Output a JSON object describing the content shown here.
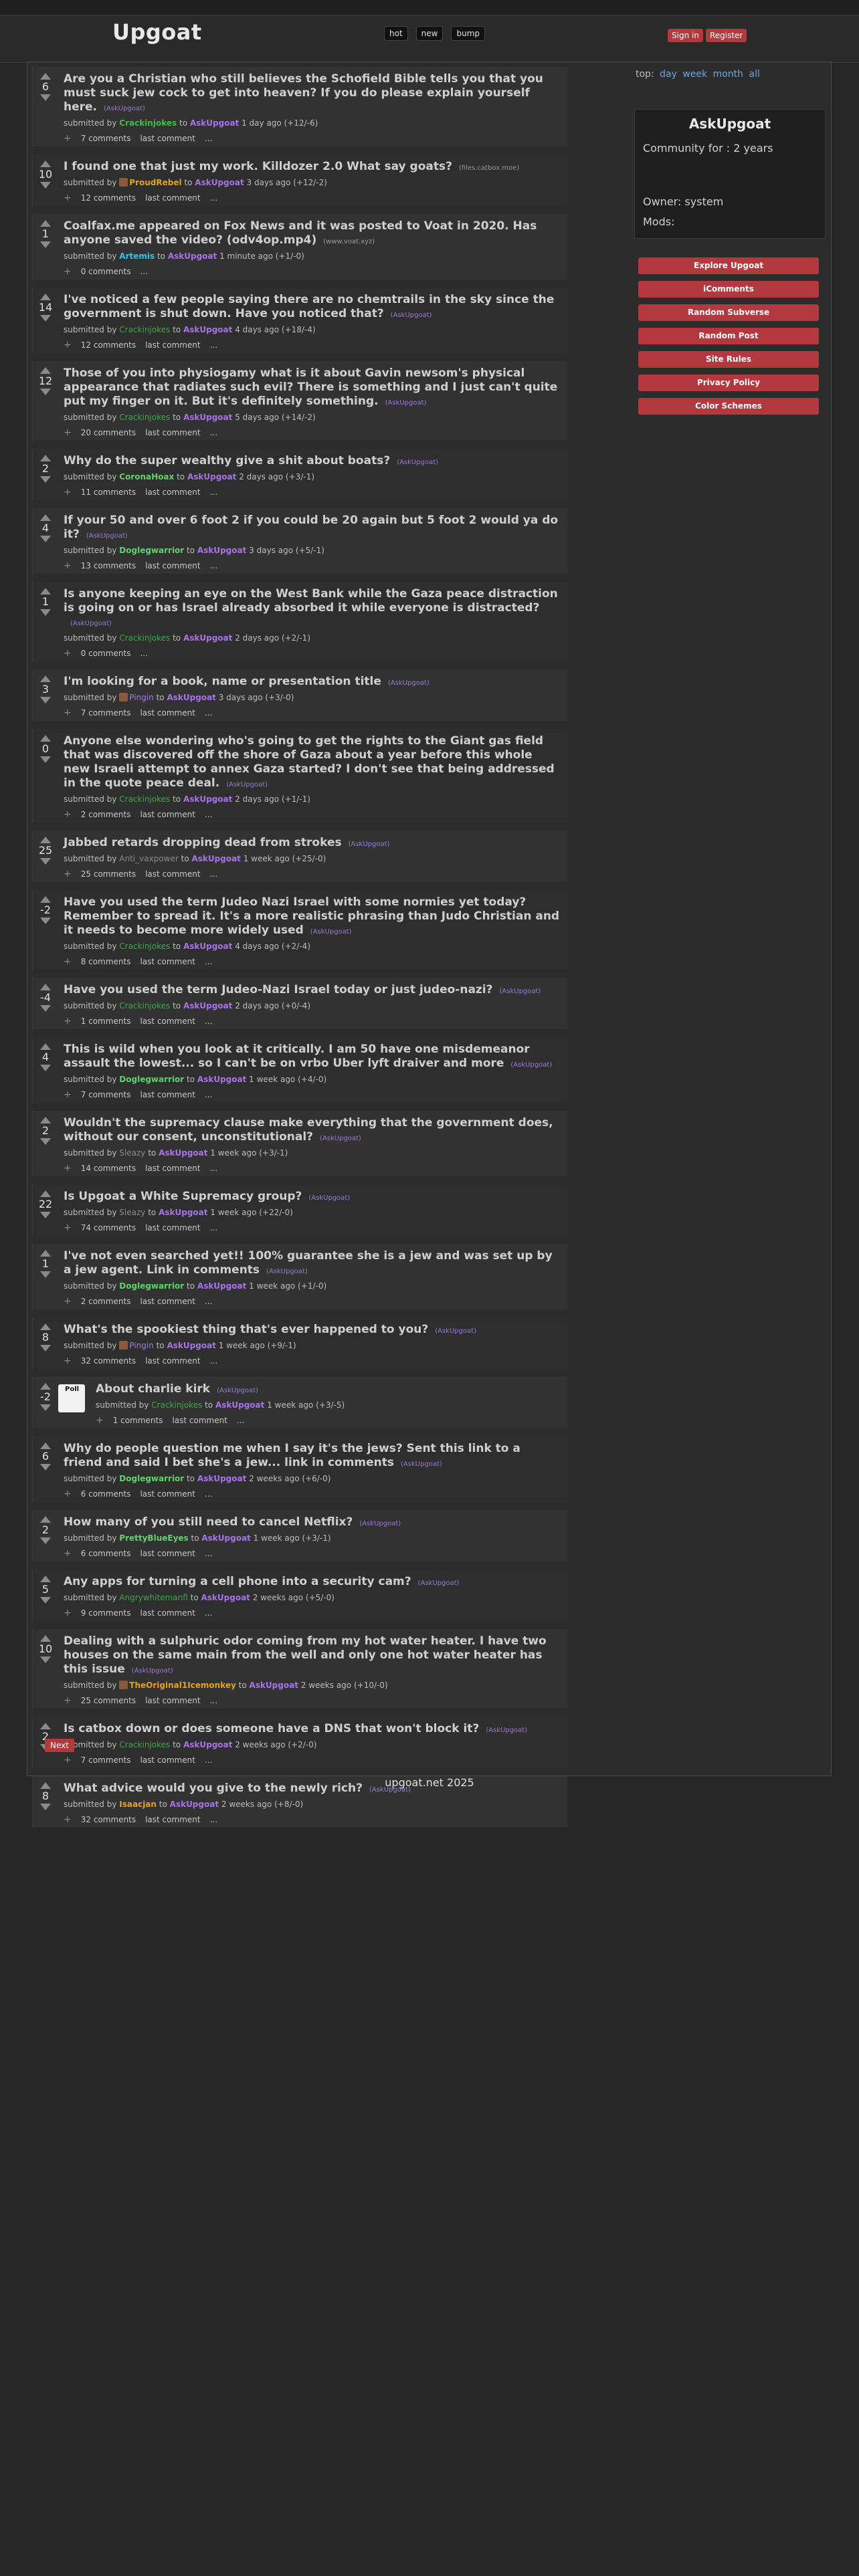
{
  "header": {
    "logo": "Upgoat",
    "sort": [
      "hot",
      "new",
      "bump"
    ],
    "sign_in": "Sign in",
    "register": "Register"
  },
  "sidebar": {
    "top_label": "top:",
    "top_links": [
      "day",
      "week",
      "month",
      "all"
    ],
    "title": "AskUpgoat",
    "community_for": "Community for : 2 years",
    "owner": "Owner: system",
    "mods": "Mods:",
    "buttons": [
      "Explore Upgoat",
      "iComments",
      "Random Subverse",
      "Random Post",
      "Site Rules",
      "Privacy Policy",
      "Color Schemes"
    ]
  },
  "posts": [
    {
      "score": "6",
      "title": "Are you a Christian who still believes the Schofield Bible tells you that you must suck jew cock to get into heaven? If you do please explain yourself here.",
      "tag": "(AskUpgoat)",
      "domain": "",
      "user": "Crackinjokes",
      "ucls": "",
      "sub": "AskUpgoat",
      "time": "1 day ago (+12/-6)",
      "comments": "7 comments",
      "last": "last comment",
      "more": "...",
      "avatar": false
    },
    {
      "score": "10",
      "title": "I found one that just my work. Killdozer 2.0 What say goats?",
      "tag": "",
      "domain": "(files.catbox.moe)",
      "user": "ProudRebel",
      "ucls": "yellow",
      "sub": "AskUpgoat",
      "time": "3 days ago (+12/-2)",
      "comments": "12 comments",
      "last": "last comment",
      "more": "...",
      "avatar": true
    },
    {
      "score": "1",
      "title": "Coalfax.me appeared on Fox News and it was posted to Voat in 2020. Has anyone saved the video? (odv4op.mp4)",
      "tag": "",
      "domain": "(www.voat.xyz)",
      "user": "Artemis",
      "ucls": "blue",
      "sub": "AskUpgoat",
      "time": "1 minute ago (+1/-0)",
      "comments": "0 comments",
      "last": "",
      "more": "...",
      "avatar": false
    },
    {
      "score": "14",
      "title": "I've noticed a few people saying there are no chemtrails in the sky since the government is shut down. Have you noticed that?",
      "tag": "(AskUpgoat)",
      "domain": "",
      "user": "Crackinjokes",
      "ucls": "dimgreen",
      "sub": "AskUpgoat",
      "time": "4 days ago (+18/-4)",
      "comments": "12 comments",
      "last": "last comment",
      "more": "...",
      "avatar": false
    },
    {
      "score": "12",
      "title": "Those of you into physiogamy what is it about Gavin newsom's physical appearance that radiates such evil? There is something and I just can't quite put my finger on it. But it's definitely something.",
      "tag": "(AskUpgoat)",
      "domain": "",
      "user": "Crackinjokes",
      "ucls": "dimgreen",
      "sub": "AskUpgoat",
      "time": "5 days ago (+14/-2)",
      "comments": "20 comments",
      "last": "last comment",
      "more": "...",
      "avatar": false
    },
    {
      "score": "2",
      "title": "Why do the super wealthy give a shit about boats?",
      "tag": "(AskUpgoat)",
      "domain": "",
      "user": "CoronaHoax",
      "ucls": "lime",
      "sub": "AskUpgoat",
      "time": "2 days ago (+3/-1)",
      "comments": "11 comments",
      "last": "last comment",
      "more": "...",
      "avatar": false
    },
    {
      "score": "4",
      "title": "If your 50 and over 6 foot 2 if you could be 20 again but 5 foot 2 would ya do it?",
      "tag": "(AskUpgoat)",
      "domain": "",
      "user": "Doglegwarrior",
      "ucls": "lime",
      "sub": "AskUpgoat",
      "time": "3 days ago (+5/-1)",
      "comments": "13 comments",
      "last": "last comment",
      "more": "...",
      "avatar": false
    },
    {
      "score": "1",
      "title": "Is anyone keeping an eye on the West Bank while the Gaza peace distraction is going on or has Israel already absorbed it while everyone is distracted?",
      "tag": "(AskUpgoat)",
      "domain": "",
      "user": "Crackinjokes",
      "ucls": "dimgreen",
      "sub": "AskUpgoat",
      "time": "2 days ago (+2/-1)",
      "comments": "0 comments",
      "last": "",
      "more": "...",
      "avatar": false
    },
    {
      "score": "3",
      "title": "I'm looking for a book, name or presentation title",
      "tag": "(AskUpgoat)",
      "domain": "",
      "user": "Pingin",
      "ucls": "purple",
      "sub": "AskUpgoat",
      "time": "3 days ago (+3/-0)",
      "comments": "7 comments",
      "last": "last comment",
      "more": "...",
      "avatar": true
    },
    {
      "score": "0",
      "title": "Anyone else wondering who's going to get the rights to the Giant gas field that was discovered off the shore of Gaza about a year before this whole new Israeli attempt to annex Gaza started? I don't see that being addressed in the quote peace deal.",
      "tag": "(AskUpgoat)",
      "domain": "",
      "user": "Crackinjokes",
      "ucls": "dimgreen",
      "sub": "AskUpgoat",
      "time": "2 days ago (+1/-1)",
      "comments": "2 comments",
      "last": "last comment",
      "more": "...",
      "avatar": false
    },
    {
      "score": "25",
      "title": "Jabbed retards dropping dead from strokes",
      "tag": "(AskUpgoat)",
      "domain": "",
      "user": "Anti_vaxpower",
      "ucls": "gray",
      "sub": "AskUpgoat",
      "time": "1 week ago (+25/-0)",
      "comments": "25 comments",
      "last": "last comment",
      "more": "...",
      "avatar": false
    },
    {
      "score": "-2",
      "title": "Have you used the term Judeo Nazi Israel with some normies yet today? Remember to spread it. It's a more realistic phrasing than Judo Christian and it needs to become more widely used",
      "tag": "(AskUpgoat)",
      "domain": "",
      "user": "Crackinjokes",
      "ucls": "dimgreen",
      "sub": "AskUpgoat",
      "time": "4 days ago (+2/-4)",
      "comments": "8 comments",
      "last": "last comment",
      "more": "...",
      "avatar": false
    },
    {
      "score": "-4",
      "title": "Have you used the term Judeo-Nazi Israel today or just judeo-nazi?",
      "tag": "(AskUpgoat)",
      "domain": "",
      "user": "Crackinjokes",
      "ucls": "dimgreen",
      "sub": "AskUpgoat",
      "time": "2 days ago (+0/-4)",
      "comments": "1 comments",
      "last": "last comment",
      "more": "...",
      "avatar": false
    },
    {
      "score": "4",
      "title": "This is wild when you look at it critically. I am 50 have one misdemeanor assault the lowest... so I can't be on vrbo Uber lyft draiver and more",
      "tag": "(AskUpgoat)",
      "domain": "",
      "user": "Doglegwarrior",
      "ucls": "lime",
      "sub": "AskUpgoat",
      "time": "1 week ago (+4/-0)",
      "comments": "7 comments",
      "last": "last comment",
      "more": "...",
      "avatar": false
    },
    {
      "score": "2",
      "title": "Wouldn't the supremacy clause make everything that the government does, without our consent, unconstitutional?",
      "tag": "(AskUpgoat)",
      "domain": "",
      "user": "Sleazy",
      "ucls": "gray",
      "sub": "AskUpgoat",
      "time": "1 week ago (+3/-1)",
      "comments": "14 comments",
      "last": "last comment",
      "more": "...",
      "avatar": false
    },
    {
      "score": "22",
      "title": "Is Upgoat a White Supremacy group?",
      "tag": "(AskUpgoat)",
      "domain": "",
      "user": "Sleazy",
      "ucls": "gray",
      "sub": "AskUpgoat",
      "time": "1 week ago (+22/-0)",
      "comments": "74 comments",
      "last": "last comment",
      "more": "...",
      "avatar": false
    },
    {
      "score": "1",
      "title": "I've not even searched yet!! 100% guarantee she is a jew and was set up by a jew agent. Link in comments",
      "tag": "(AskUpgoat)",
      "domain": "",
      "user": "Doglegwarrior",
      "ucls": "lime",
      "sub": "AskUpgoat",
      "time": "1 week ago (+1/-0)",
      "comments": "2 comments",
      "last": "last comment",
      "more": "...",
      "avatar": false
    },
    {
      "score": "8",
      "title": "What's the spookiest thing that's ever happened to you?",
      "tag": "(AskUpgoat)",
      "domain": "",
      "user": "Pingin",
      "ucls": "purple",
      "sub": "AskUpgoat",
      "time": "1 week ago (+9/-1)",
      "comments": "32 comments",
      "last": "last comment",
      "more": "...",
      "avatar": true
    },
    {
      "score": "-2",
      "title": "About charlie kirk",
      "tag": "(AskUpgoat)",
      "domain": "",
      "user": "Crackinjokes",
      "ucls": "dimgreen",
      "sub": "AskUpgoat",
      "time": "1 week ago (+3/-5)",
      "comments": "1 comments",
      "last": "last comment",
      "more": "...",
      "avatar": false,
      "thumb": "Poll"
    },
    {
      "score": "6",
      "title": "Why do people question me when I say it's the jews? Sent this link to a friend and said I bet she's a jew... link in comments",
      "tag": "(AskUpgoat)",
      "domain": "",
      "user": "Doglegwarrior",
      "ucls": "lime",
      "sub": "AskUpgoat",
      "time": "2 weeks ago (+6/-0)",
      "comments": "6 comments",
      "last": "last comment",
      "more": "...",
      "avatar": false
    },
    {
      "score": "2",
      "title": "How many of you still need to cancel Netflix?",
      "tag": "(AskUpgoat)",
      "domain": "",
      "user": "PrettyBlueEyes",
      "ucls": "lime",
      "sub": "AskUpgoat",
      "time": "1 week ago (+3/-1)",
      "comments": "6 comments",
      "last": "last comment",
      "more": "...",
      "avatar": false
    },
    {
      "score": "5",
      "title": "Any apps for turning a cell phone into a security cam?",
      "tag": "(AskUpgoat)",
      "domain": "",
      "user": "Angrywhitemanfl",
      "ucls": "dimgreen",
      "sub": "AskUpgoat",
      "time": "2 weeks ago (+5/-0)",
      "comments": "9 comments",
      "last": "last comment",
      "more": "...",
      "avatar": false
    },
    {
      "score": "10",
      "title": "Dealing with a sulphuric odor coming from my hot water heater. I have two houses on the same main from the well and only one hot water heater has this issue",
      "tag": "(AskUpgoat)",
      "domain": "",
      "user": "TheOriginal1Icemonkey",
      "ucls": "yellow",
      "sub": "AskUpgoat",
      "time": "2 weeks ago (+10/-0)",
      "comments": "25 comments",
      "last": "last comment",
      "more": "...",
      "avatar": true
    },
    {
      "score": "2",
      "title": "Is catbox down or does someone have a DNS that won't block it?",
      "tag": "(AskUpgoat)",
      "domain": "",
      "user": "Crackinjokes",
      "ucls": "dimgreen",
      "sub": "AskUpgoat",
      "time": "2 weeks ago (+2/-0)",
      "comments": "7 comments",
      "last": "last comment",
      "more": "...",
      "avatar": false
    },
    {
      "score": "8",
      "title": "What advice would you give to the newly rich?",
      "tag": "(AskUpgoat)",
      "domain": "",
      "user": "Isaacjan",
      "ucls": "yellow",
      "sub": "AskUpgoat",
      "time": "2 weeks ago (+8/-0)",
      "comments": "32 comments",
      "last": "last comment",
      "more": "...",
      "avatar": false
    }
  ],
  "submitted_by": "submitted by",
  "to_label": "to",
  "next": "Next",
  "footer": "upgoat.net 2025"
}
